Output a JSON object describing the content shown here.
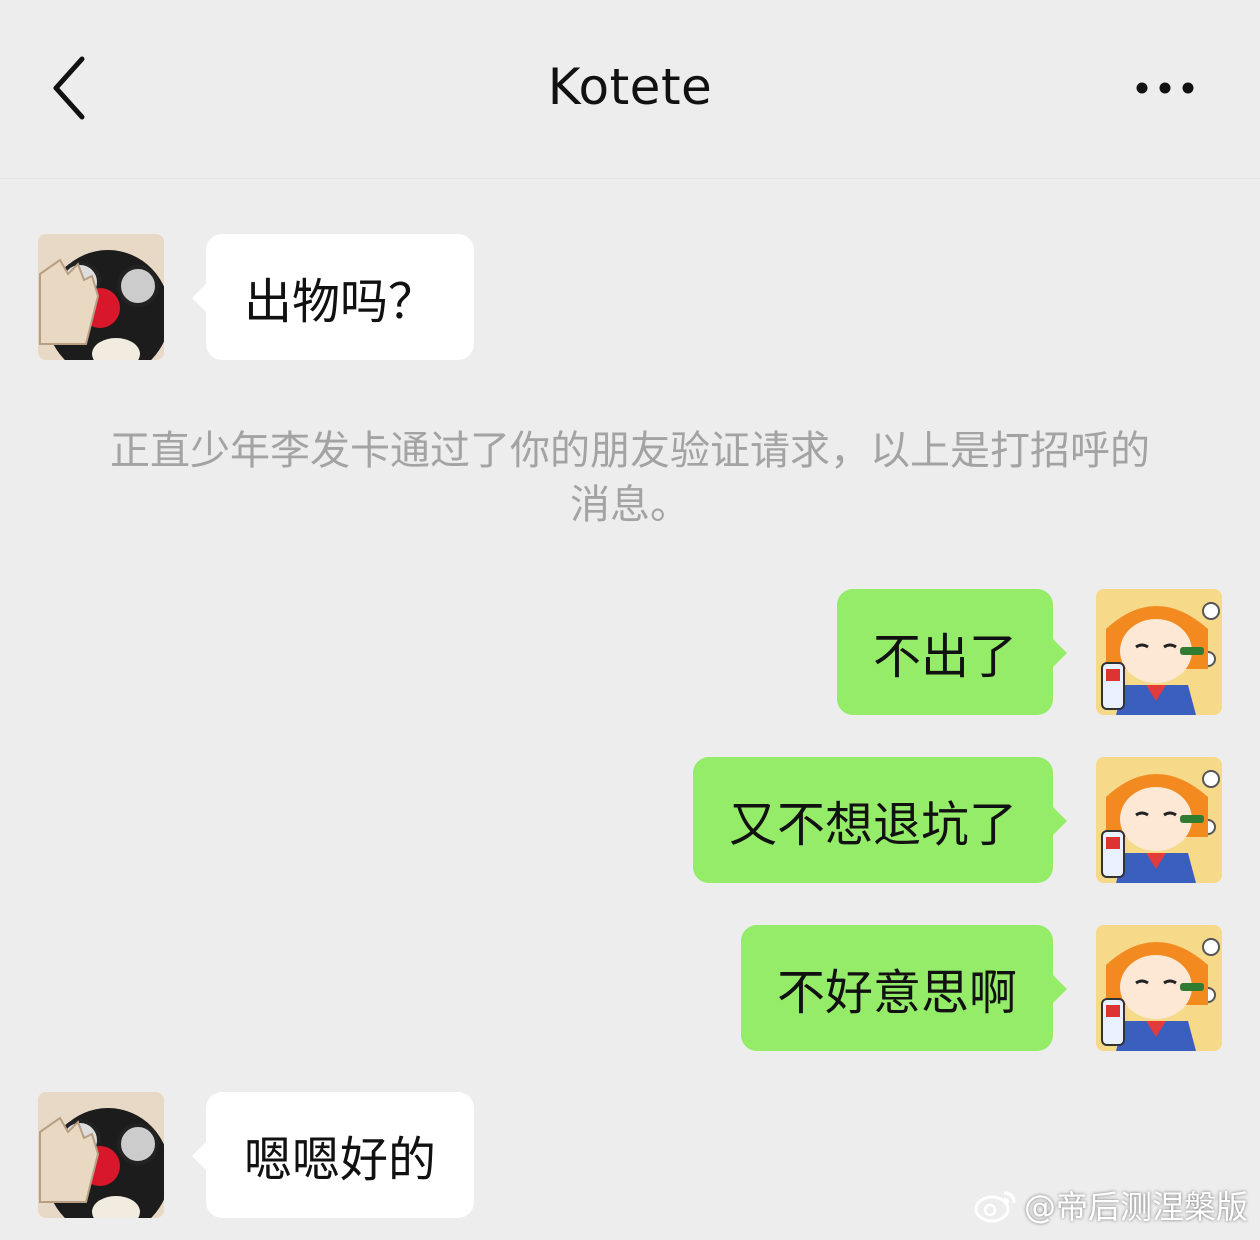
{
  "header": {
    "title": "Kotete",
    "back_icon": "chevron-left-icon",
    "more_icon": "more-horizontal-icon"
  },
  "messages": [
    {
      "side": "in",
      "text": "出物吗？"
    },
    {
      "side": "system",
      "text": "正直少年李发卡通过了你的朋友验证请求，以上是打招呼的消息。"
    },
    {
      "side": "out",
      "text": "不出了"
    },
    {
      "side": "out",
      "text": "又不想退坑了"
    },
    {
      "side": "out",
      "text": "不好意思啊"
    },
    {
      "side": "in",
      "text": "嗯嗯好的"
    }
  ],
  "watermark": {
    "text": "@帝后测涅槃版",
    "icon": "weibo-icon"
  },
  "colors": {
    "background": "#ededed",
    "incoming_bubble": "#ffffff",
    "outgoing_bubble": "#95ec69",
    "system_text": "#a3a3a3"
  }
}
